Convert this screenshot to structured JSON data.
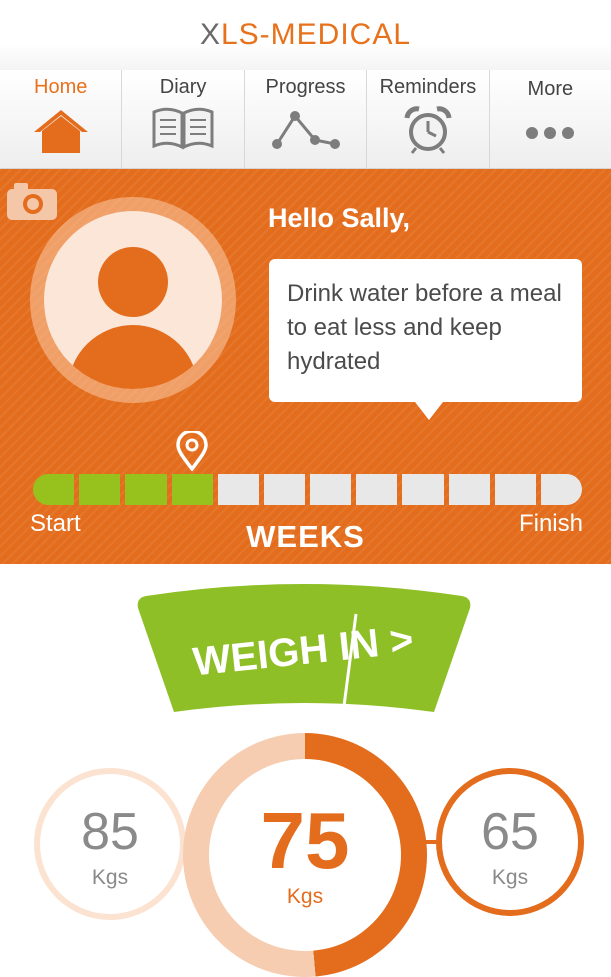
{
  "app": {
    "logo_x": "X",
    "logo_rest": "LS-MEDICAL"
  },
  "colors": {
    "accent_orange": "#e36d1d",
    "progress_green": "#97c21d",
    "light_peach": "#fbe2d1"
  },
  "nav": {
    "items": [
      {
        "label": "Home",
        "icon": "home-icon",
        "active": true
      },
      {
        "label": "Diary",
        "icon": "book-icon",
        "active": false
      },
      {
        "label": "Progress",
        "icon": "line-chart-icon",
        "active": false
      },
      {
        "label": "Reminders",
        "icon": "alarm-clock-icon",
        "active": false
      },
      {
        "label": "More",
        "icon": "more-dots-icon",
        "active": false
      }
    ]
  },
  "profile": {
    "camera_icon": "camera-icon",
    "avatar_icon": "user-avatar-icon",
    "greeting": "Hello Sally,",
    "tip": "Drink water before a meal to eat less and keep hydrated"
  },
  "progress": {
    "weeks_completed": 4,
    "weeks_total": 12,
    "start_label": "Start",
    "finish_label": "Finish",
    "weeks_label": "WEEKS",
    "marker_icon": "location-pin-icon"
  },
  "weigh_in": {
    "button_label": "WEIGH IN >",
    "start_weight": "85",
    "start_unit": "Kgs",
    "current_weight": "75",
    "current_unit": "Kgs",
    "goal_weight": "65",
    "goal_unit": "Kgs"
  }
}
